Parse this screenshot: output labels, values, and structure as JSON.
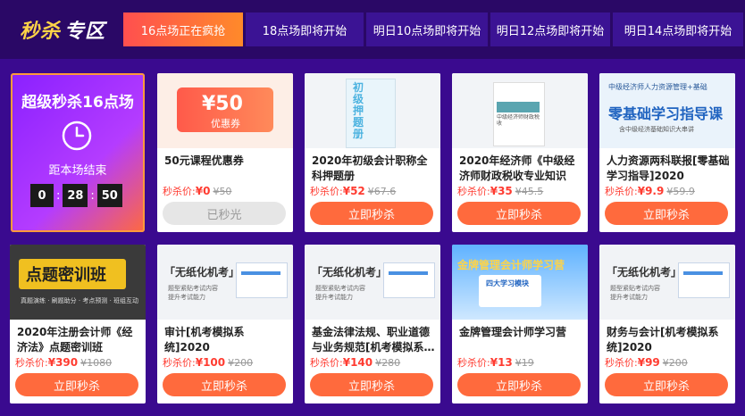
{
  "header": {
    "logo_part1": "秒杀",
    "logo_part2": "专区",
    "tabs": [
      {
        "label": "16点场正在疯抢",
        "active": true
      },
      {
        "label": "18点场即将开始",
        "active": false
      },
      {
        "label": "明日10点场即将开始",
        "active": false
      },
      {
        "label": "明日12点场即将开始",
        "active": false
      },
      {
        "label": "明日14点场即将开始",
        "active": false
      }
    ]
  },
  "promo": {
    "title": "超级秒杀16点场",
    "subtitle": "距本场结束",
    "hours": "0",
    "minutes": "28",
    "seconds": "50"
  },
  "labels": {
    "price_prefix": "秒杀价:",
    "currency": "¥"
  },
  "products": [
    {
      "title": "50元课程优惠券",
      "price": "0",
      "old_price": "50",
      "button": "已秒光",
      "sold_out": true,
      "img_text_main": "¥50",
      "img_text_sub": "优惠券"
    },
    {
      "title": "2020年初级会计职称全科押题册",
      "price": "52",
      "old_price": "67.6",
      "button": "立即秒杀",
      "img_text_main": "初级押题册"
    },
    {
      "title": "2020年经济师《中级经济师财政税收专业知识与…",
      "price": "35",
      "old_price": "45.5",
      "button": "立即秒杀",
      "img_text_main": "中级经济师财政税收"
    },
    {
      "title": "人力资源两科联报[零基础学习指导]2020",
      "price": "9.9",
      "old_price": "59.9",
      "button": "立即秒杀",
      "img_text_top": "中级经济师人力资源管理+基础",
      "img_text_main": "零基础学习指导课",
      "img_text_sub": "含中级经济基础知识大串讲"
    },
    {
      "title": "2020年注册会计师《经济法》点题密训班",
      "price": "390",
      "old_price": "1080",
      "button": "立即秒杀",
      "img_text_main": "点题密训班",
      "img_text_sub": "真题演练 · 刷题助分 · 考点预测 · 班组互动"
    },
    {
      "title": "审计[机考模拟系统]2020",
      "price": "100",
      "old_price": "200",
      "button": "立即秒杀",
      "img_text_main": "「无纸化机考」",
      "img_text_sub": "题型紧贴考试内容 提升考试能力"
    },
    {
      "title": "基金法律法规、职业道德与业务规范[机考模拟系…",
      "price": "140",
      "old_price": "280",
      "button": "立即秒杀",
      "img_text_main": "「无纸化机考」",
      "img_text_sub": "题型紧贴考试内容 提升考试能力"
    },
    {
      "title": "金牌管理会计师学习营",
      "price": "13",
      "old_price": "19",
      "button": "立即秒杀",
      "img_text_main": "金牌管理会计师学习营",
      "img_text_sub": "四大学习模块"
    },
    {
      "title": "财务与会计[机考模拟系统]2020",
      "price": "99",
      "old_price": "200",
      "button": "立即秒杀",
      "img_text_main": "「无纸化机考」",
      "img_text_sub": "题型紧贴考试内容 提升考试能力"
    }
  ],
  "colors": {
    "background": "#3a0a8f",
    "header": "#2a0866",
    "accent": "#ff6a3d",
    "price": "#ff3b30"
  }
}
